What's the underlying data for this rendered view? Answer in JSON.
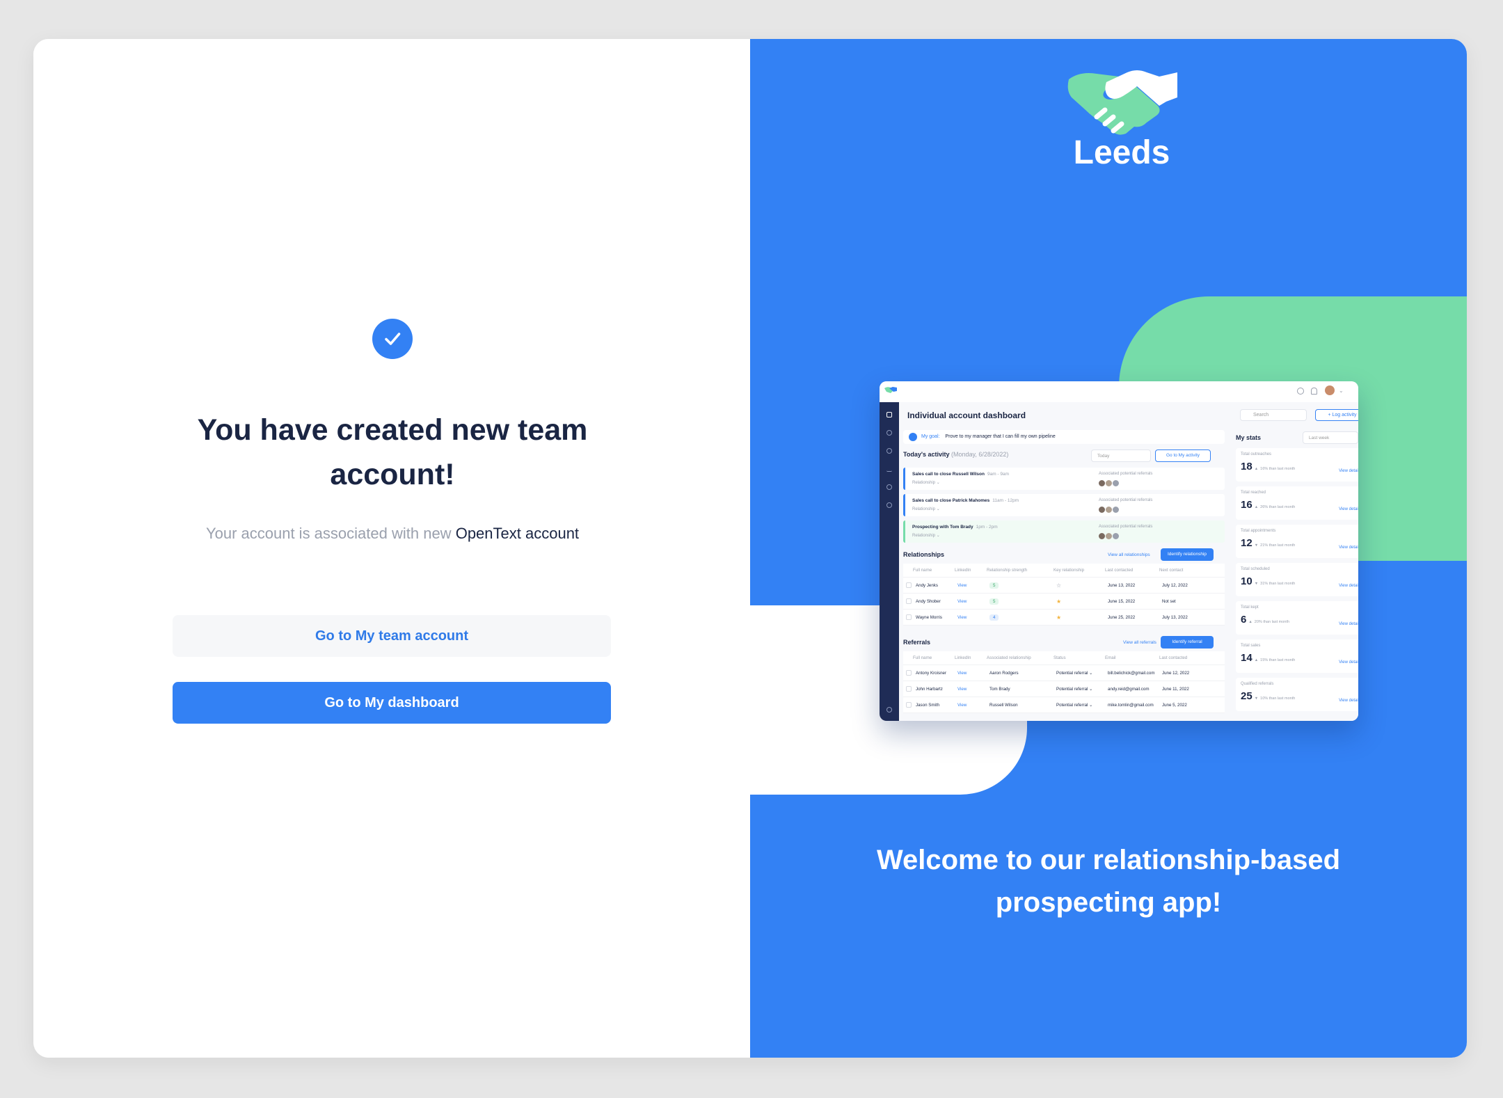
{
  "left": {
    "title": "You have created new team account!",
    "subtitle_muted": "Your account is associated with new",
    "subtitle_strong": "OpenText account",
    "secondary_button": "Go to My team account",
    "primary_button": "Go to My dashboard"
  },
  "right": {
    "brand": "Leeds",
    "welcome": "Welcome to our relationship-based prospecting app!",
    "colors": {
      "blue": "#3381f4",
      "green": "#76dca9",
      "navy": "#1a2543"
    }
  },
  "dashboard": {
    "title": "Individual account dashboard",
    "search_placeholder": "Search",
    "log_activity": "+ Log activity",
    "goal_label": "My goal:",
    "goal_text": "Prove to my manager that I can fill my own pipeline",
    "activity_title": "Today's activity",
    "activity_date": "(Monday, 6/28/2022)",
    "activity_filter": "Today",
    "go_activity": "Go to My activity",
    "associated_label": "Associated potential referrals",
    "relationship_label": "Relationship",
    "activities": [
      {
        "title": "Sales call to close Russell Wilson",
        "time": "9am - 9am"
      },
      {
        "title": "Sales call to close Patrick Mahomes",
        "time": "11am - 12pm"
      },
      {
        "title": "Prospecting with Tom Brady",
        "time": "1pm - 2pm"
      }
    ],
    "relationships_title": "Relationships",
    "view_all_relationships": "View all relationships",
    "identify_relationship": "Identify relationship",
    "rel_headers": [
      "Full name",
      "LinkedIn",
      "Relationship strength",
      "Key relationship",
      "Last contacted",
      "Next contact"
    ],
    "rel_rows": [
      {
        "name": "Andy Jenks",
        "link": "View",
        "strength": "5",
        "key": "outline",
        "last": "June 13, 2022",
        "next": "July 12, 2022"
      },
      {
        "name": "Andy Shober",
        "link": "View",
        "strength": "5",
        "key": "filled",
        "last": "June 15, 2022",
        "next": "Not set"
      },
      {
        "name": "Wayne Morris",
        "link": "View",
        "strength": "4",
        "key": "filled",
        "last": "June 25, 2022",
        "next": "July 13, 2022"
      }
    ],
    "referrals_title": "Referrals",
    "view_all_referrals": "View all referrals",
    "identify_referral": "Identify referral",
    "ref_headers": [
      "Full name",
      "LinkedIn",
      "Associated relationship",
      "Status",
      "Email",
      "Last contacted"
    ],
    "ref_rows": [
      {
        "name": "Antony Kroisner",
        "link": "View",
        "assoc": "Aaron Rodgers",
        "status": "Potential referral",
        "email": "bill.belichick@gmail.com",
        "last": "June 12, 2022"
      },
      {
        "name": "John Harbartz",
        "link": "View",
        "assoc": "Tom Brady",
        "status": "Potential referral",
        "email": "andy.reid@gmail.com",
        "last": "June 11, 2022"
      },
      {
        "name": "Jason Smith",
        "link": "View",
        "assoc": "Russell Wilson",
        "status": "Potential referral",
        "email": "mike.tomlin@gmail.com",
        "last": "June 5, 2022"
      }
    ],
    "stats_title": "My stats",
    "stats_filter": "Last week",
    "view_details": "View details",
    "stats": [
      {
        "label": "Total outreaches",
        "value": "18",
        "dir": "up",
        "delta": "16% than last month"
      },
      {
        "label": "Total reached",
        "value": "16",
        "dir": "up",
        "delta": "26% than last month"
      },
      {
        "label": "Total appointments",
        "value": "12",
        "dir": "down",
        "delta": "21% than last month"
      },
      {
        "label": "Total scheduled",
        "value": "10",
        "dir": "down",
        "delta": "31% than last month"
      },
      {
        "label": "Total kept",
        "value": "6",
        "dir": "up",
        "delta": "20% than last month"
      },
      {
        "label": "Total sales",
        "value": "14",
        "dir": "up",
        "delta": "15% than last month"
      },
      {
        "label": "Qualified referrals",
        "value": "25",
        "dir": "down",
        "delta": "10% than last month"
      }
    ]
  }
}
